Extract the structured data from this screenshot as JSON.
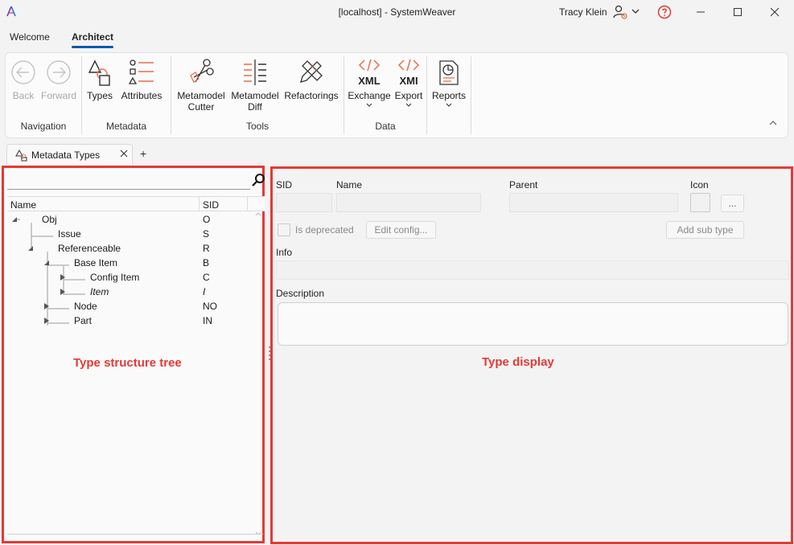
{
  "window": {
    "title": "[localhost] - SystemWeaver",
    "user": "Tracy Klein"
  },
  "ribbon_tabs": [
    {
      "label": "Welcome",
      "active": false
    },
    {
      "label": "Architect",
      "active": true
    }
  ],
  "ribbon": {
    "groups": {
      "navigation": "Navigation",
      "metadata": "Metadata",
      "tools": "Tools",
      "data": "Data"
    },
    "buttons": {
      "back": "Back",
      "forward": "Forward",
      "types": "Types",
      "attributes": "Attributes",
      "metamodel_cutter": [
        "Metamodel",
        "Cutter"
      ],
      "metamodel_diff": [
        "Metamodel",
        "Diff"
      ],
      "refactorings": "Refactorings",
      "exchange": "Exchange",
      "exchange_icon_text": "XML",
      "export": "Export",
      "export_icon_text": "XMI",
      "reports": "Reports"
    }
  },
  "doc_tabs": [
    {
      "label": "Metadata Types"
    }
  ],
  "add_tab_label": "+",
  "tree": {
    "columns": [
      "Name",
      "SID"
    ],
    "rows": [
      {
        "name": "Obj",
        "sid": "O",
        "level": 0,
        "expanded": true,
        "italic": false
      },
      {
        "name": "Issue",
        "sid": "S",
        "level": 1,
        "expanded": null,
        "italic": false
      },
      {
        "name": "Referenceable",
        "sid": "R",
        "level": 1,
        "expanded": true,
        "italic": false
      },
      {
        "name": "Base Item",
        "sid": "B",
        "level": 2,
        "expanded": true,
        "italic": false
      },
      {
        "name": "Config Item",
        "sid": "C",
        "level": 3,
        "expanded": false,
        "italic": false
      },
      {
        "name": "Item",
        "sid": "I",
        "level": 3,
        "expanded": false,
        "italic": true
      },
      {
        "name": "Node",
        "sid": "NO",
        "level": 2,
        "expanded": false,
        "italic": false
      },
      {
        "name": "Part",
        "sid": "IN",
        "level": 2,
        "expanded": false,
        "italic": false
      }
    ],
    "annotation": "Type structure tree"
  },
  "detail": {
    "labels": {
      "sid": "SID",
      "name": "Name",
      "parent": "Parent",
      "icon": "Icon",
      "info": "Info",
      "description": "Description",
      "is_deprecated": "Is deprecated"
    },
    "values": {
      "sid": "",
      "name": "",
      "parent": "",
      "info": "",
      "description": ""
    },
    "buttons": {
      "icon_browse": "...",
      "edit_config": "Edit config...",
      "add_sub_type": "Add sub type"
    },
    "annotation": "Type display"
  },
  "colors": {
    "accent_tab": "#0f5aa8",
    "annotation_red": "#e53935",
    "icon_orange": "#e8704a"
  }
}
